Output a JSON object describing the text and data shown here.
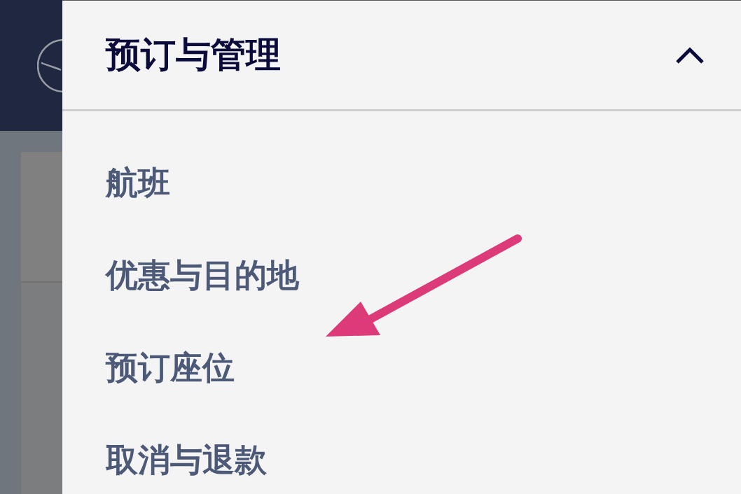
{
  "menu": {
    "title": "预订与管理",
    "expanded": true
  },
  "menu_items": [
    {
      "label": "航班"
    },
    {
      "label": "优惠与目的地"
    },
    {
      "label": "预订座位"
    },
    {
      "label": "取消与退款"
    }
  ]
}
